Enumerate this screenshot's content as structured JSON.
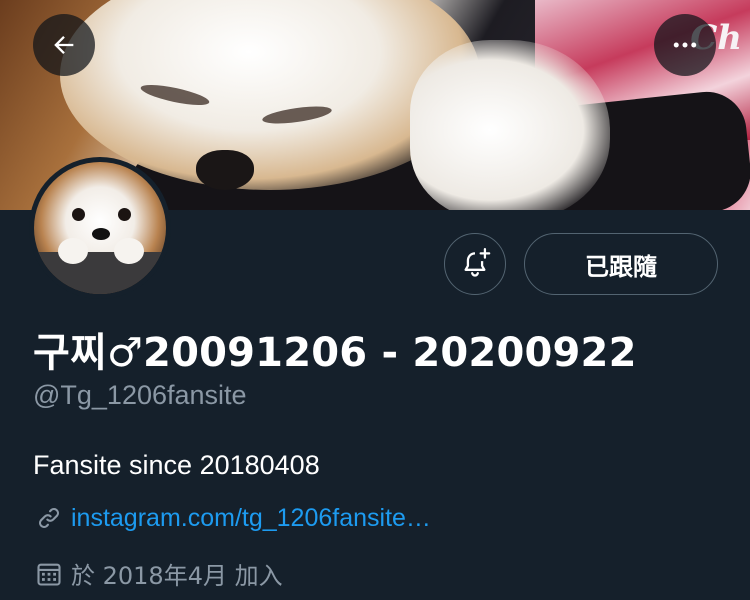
{
  "header": {
    "back_icon": "arrow-left-icon",
    "more_icon": "more-horizontal-icon",
    "banner_poster_text": "Ch"
  },
  "profile": {
    "display_name": "구찌♂20091206 - 20200922",
    "handle": "@Tg_1206fansite",
    "bio": "Fansite since 20180408",
    "link": "instagram.com/tg_1206fansite…",
    "joined": "於 2018年4月 加入"
  },
  "actions": {
    "notify_icon": "bell-plus-icon",
    "follow_label": "已跟隨"
  },
  "colors": {
    "background": "#15202b",
    "link": "#1d9bf0",
    "secondary_text": "#8b98a5",
    "button_border": "#536471"
  }
}
